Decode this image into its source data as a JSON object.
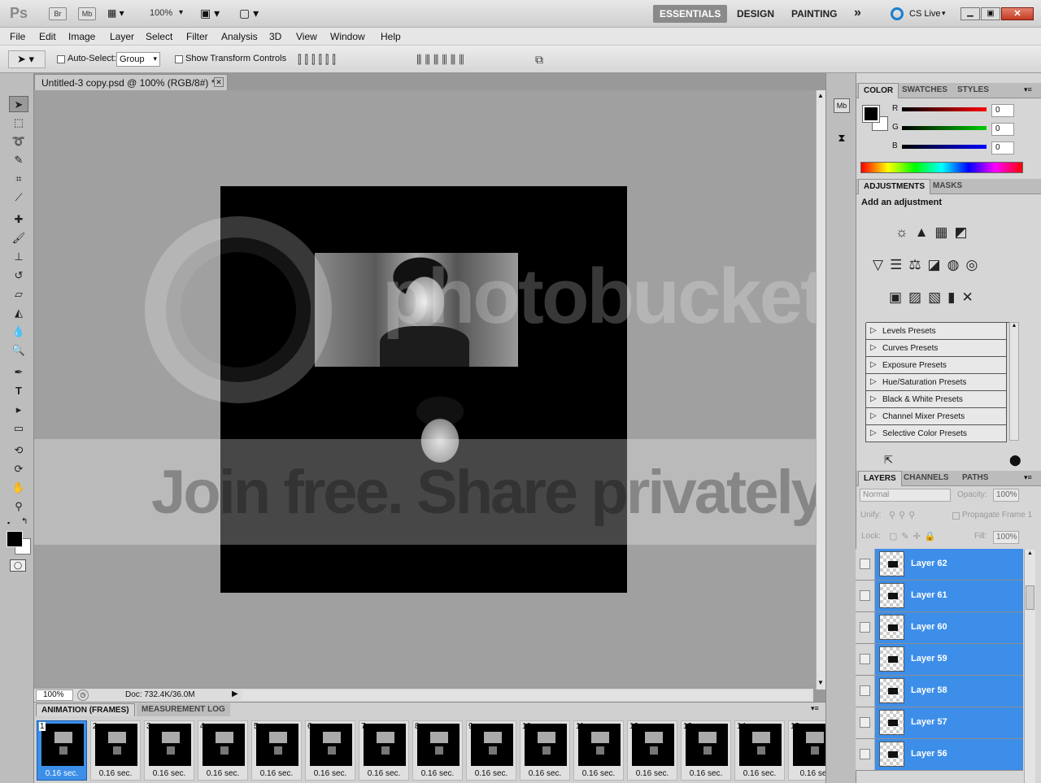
{
  "app": {
    "logo": "Ps",
    "bridge": "Br",
    "minibridge": "Mb",
    "zoom": "100%"
  },
  "workspaces": {
    "essentials": "ESSENTIALS",
    "design": "DESIGN",
    "painting": "PAINTING",
    "more": "»",
    "cslive": "CS Live"
  },
  "menu": [
    "File",
    "Edit",
    "Image",
    "Layer",
    "Select",
    "Filter",
    "Analysis",
    "3D",
    "View",
    "Window",
    "Help"
  ],
  "options": {
    "auto_select_label": "Auto-Select:",
    "auto_select_value": "Group",
    "show_transform": "Show Transform Controls"
  },
  "document": {
    "tab_title": "Untitled-3 copy.psd @ 100% (RGB/8#) *",
    "zoom": "100%",
    "doc_size": "Doc: 732.4K/36.0M"
  },
  "watermark": {
    "top": "photobucket",
    "bottom": "Join free. Share privately."
  },
  "animation": {
    "tabs": [
      "ANIMATION (FRAMES)",
      "MEASUREMENT LOG"
    ],
    "frames": [
      {
        "num": "1",
        "dur": "0.16 sec."
      },
      {
        "num": "2",
        "dur": "0.16 sec."
      },
      {
        "num": "3",
        "dur": "0.16 sec."
      },
      {
        "num": "4",
        "dur": "0.16 sec."
      },
      {
        "num": "5",
        "dur": "0.16 sec."
      },
      {
        "num": "6",
        "dur": "0.16 sec."
      },
      {
        "num": "7",
        "dur": "0.16 sec."
      },
      {
        "num": "8",
        "dur": "0.16 sec."
      },
      {
        "num": "9",
        "dur": "0.16 sec."
      },
      {
        "num": "10",
        "dur": "0.16 sec."
      },
      {
        "num": "11",
        "dur": "0.16 sec."
      },
      {
        "num": "12",
        "dur": "0.16 sec."
      },
      {
        "num": "13",
        "dur": "0.16 sec."
      },
      {
        "num": "14",
        "dur": "0.16 sec."
      },
      {
        "num": "15",
        "dur": "0.16 se"
      }
    ]
  },
  "color_panel": {
    "tabs": [
      "COLOR",
      "SWATCHES",
      "STYLES"
    ],
    "r_label": "R",
    "g_label": "G",
    "b_label": "B",
    "r": "0",
    "g": "0",
    "b": "0"
  },
  "adjustments": {
    "tabs": [
      "ADJUSTMENTS",
      "MASKS"
    ],
    "heading": "Add an adjustment",
    "presets": [
      "Levels Presets",
      "Curves Presets",
      "Exposure Presets",
      "Hue/Saturation Presets",
      "Black & White Presets",
      "Channel Mixer Presets",
      "Selective Color Presets"
    ]
  },
  "layers_panel": {
    "tabs": [
      "LAYERS",
      "CHANNELS",
      "PATHS"
    ],
    "blend": "Normal",
    "opacity_label": "Opacity:",
    "opacity": "100%",
    "unify_label": "Unify:",
    "propagate": "Propagate Frame 1",
    "lock_label": "Lock:",
    "fill_label": "Fill:",
    "fill": "100%",
    "layers": [
      "Layer 62",
      "Layer 61",
      "Layer 60",
      "Layer 59",
      "Layer 58",
      "Layer 57",
      "Layer 56"
    ]
  },
  "colors": {
    "selection": "#3d8ee9",
    "active_workspace": "#8a8a8a"
  }
}
